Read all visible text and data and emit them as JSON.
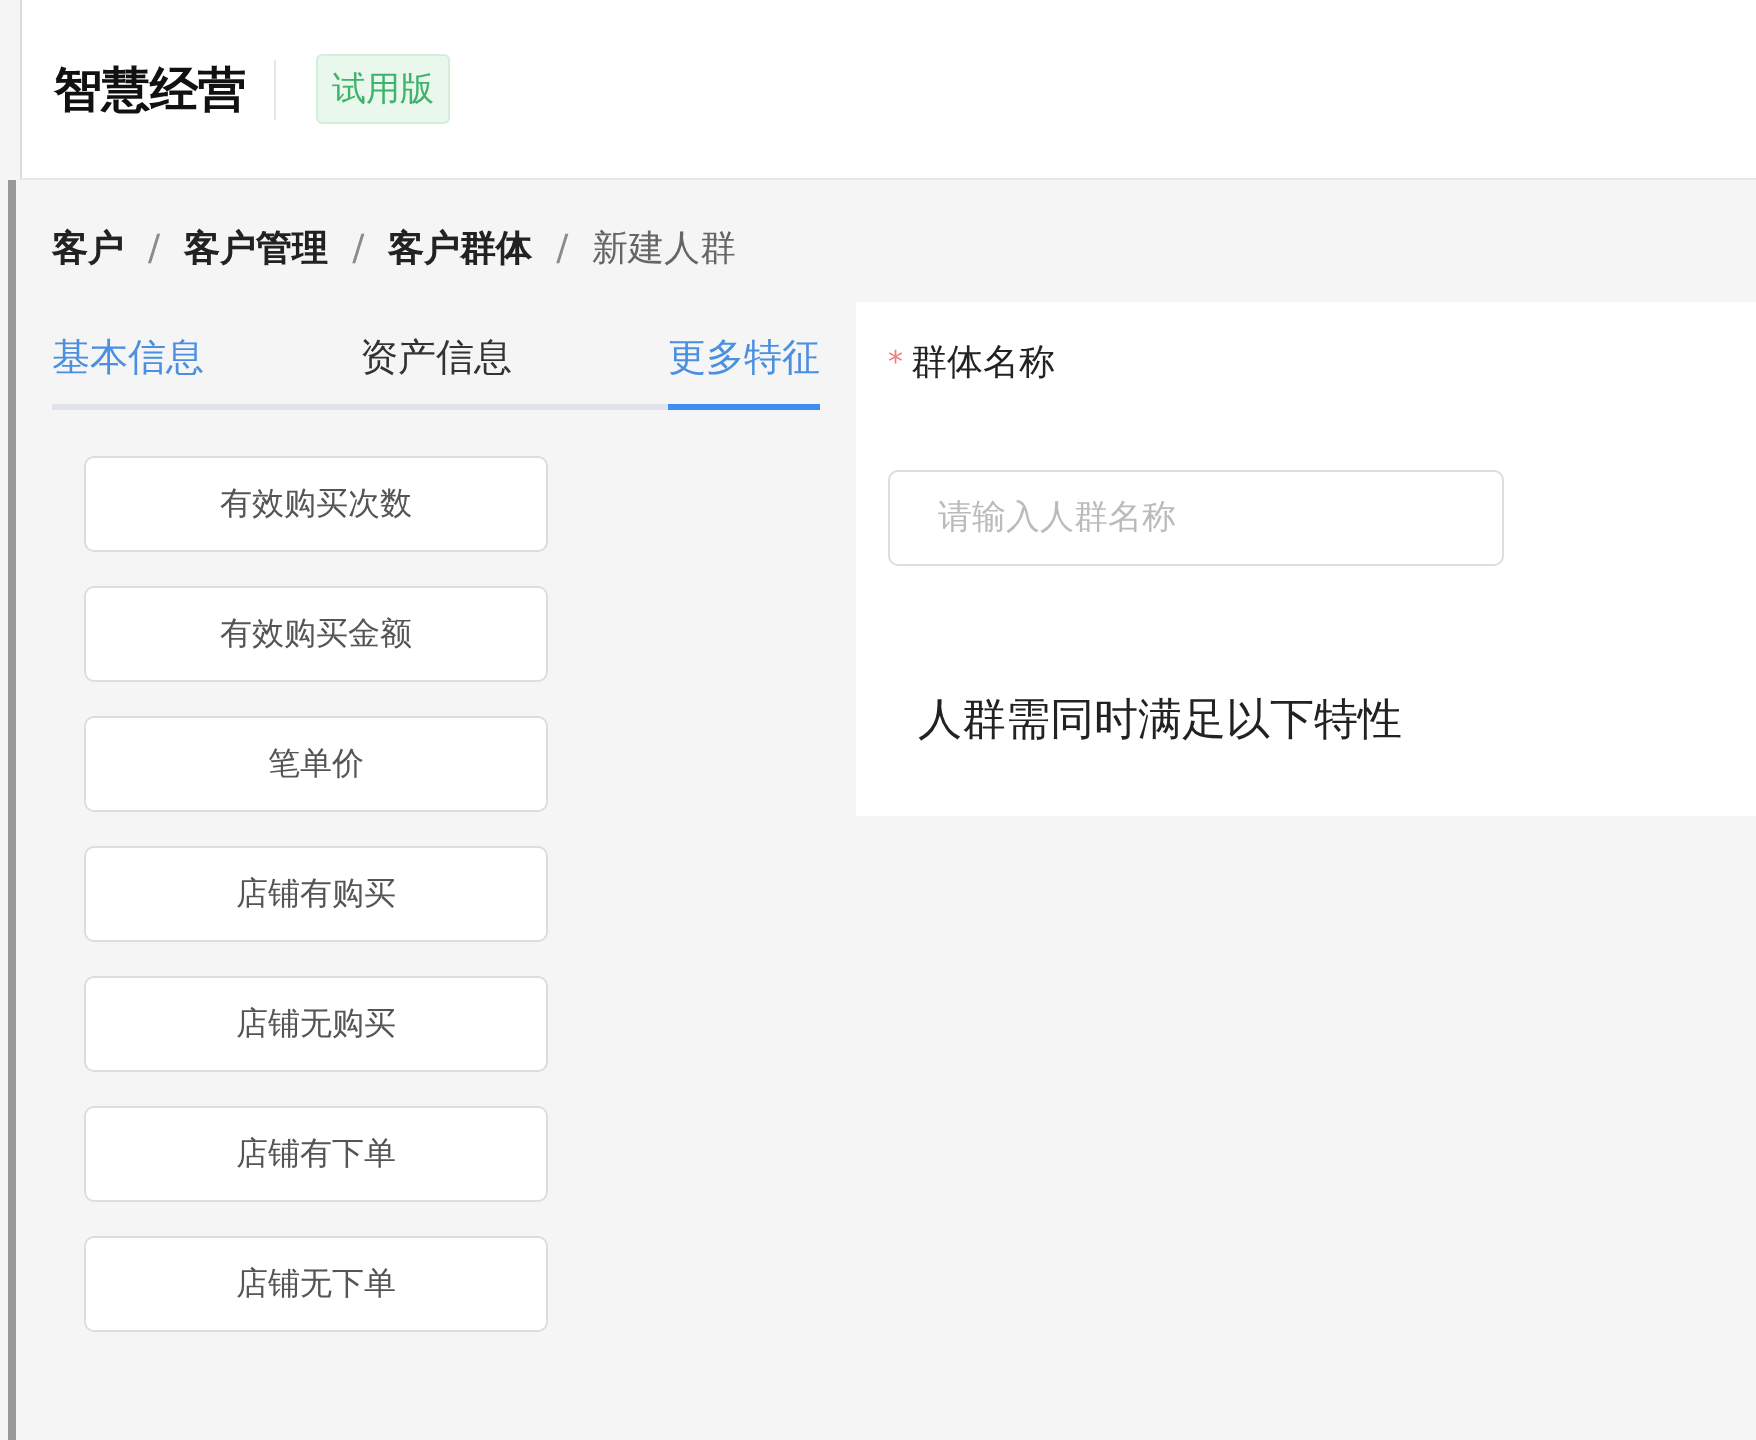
{
  "header": {
    "title": "智慧经营",
    "badge": "试用版"
  },
  "breadcrumb": [
    {
      "label": "客户",
      "current": false
    },
    {
      "label": "客户管理",
      "current": false
    },
    {
      "label": "客户群体",
      "current": false
    },
    {
      "label": "新建人群",
      "current": true
    }
  ],
  "breadcrumb_separator": "/",
  "tabs": [
    {
      "label": "基本信息",
      "selected": false,
      "highlighted": true
    },
    {
      "label": "资产信息",
      "selected": false,
      "highlighted": false
    },
    {
      "label": "更多特征",
      "selected": true,
      "highlighted": false
    }
  ],
  "features": [
    "有效购买次数",
    "有效购买金额",
    "笔单价",
    "店铺有购买",
    "店铺无购买",
    "店铺有下单",
    "店铺无下单"
  ],
  "form": {
    "required_mark": "*",
    "label": "群体名称",
    "placeholder": "请输入人群名称",
    "condition_title": "人群需同时满足以下特性"
  }
}
